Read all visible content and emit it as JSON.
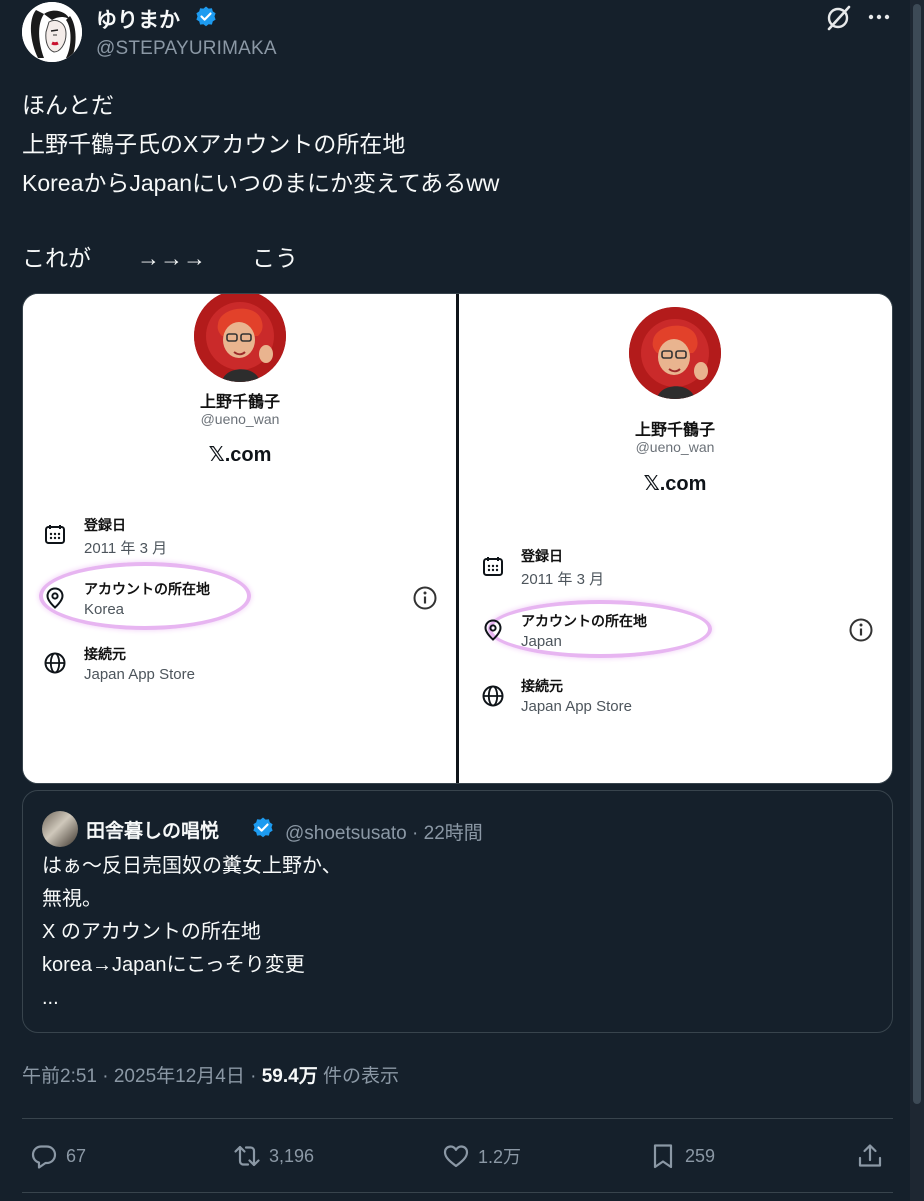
{
  "author": {
    "display_name": "ゆりまか",
    "handle": "@STEPAYURIMAKA",
    "verified": true
  },
  "icons": {
    "grok": "grok-slash-icon",
    "more": "more-icon",
    "reply": "reply-icon",
    "repost": "repost-icon",
    "like": "heart-icon",
    "bookmark": "bookmark-icon",
    "share": "share-icon"
  },
  "tweet_text": {
    "line1": "ほんとだ",
    "line2": "上野千鶴子氏のXアカウントの所在地",
    "line3": "KoreaからJapanにいつのまにか変えてあるww",
    "line4": "これが　　→→→　　こう"
  },
  "media": {
    "left": {
      "name": "上野千鶴子",
      "handle": "@ueno_wan",
      "site": "𝕏.com",
      "joined_label": "登録日",
      "joined_value": "2011 年 3 月",
      "location_label": "アカウントの所在地",
      "location_value": "Korea",
      "connected_label": "接続元",
      "connected_value": "Japan App Store"
    },
    "right": {
      "name": "上野千鶴子",
      "handle": "@ueno_wan",
      "site": "𝕏.com",
      "joined_label": "登録日",
      "joined_value": "2011 年 3 月",
      "location_label": "アカウントの所在地",
      "location_value": "Japan",
      "connected_label": "接続元",
      "connected_value": "Japan App Store"
    }
  },
  "quote": {
    "display_name": "田舎暮しの唱悦",
    "handle_time": "@shoetsusato · 22時間",
    "line1": "はぁ～反日売国奴の糞女上野か、",
    "line2": "無視。",
    "line3": "X のアカウントの所在地",
    "line4": "korea→Japanにこっそり変更",
    "line5": "..."
  },
  "meta": {
    "time_date": "午前2:51 · 2025年12月4日 · ",
    "views": "59.4万",
    "views_suffix": " 件の表示"
  },
  "actions": {
    "replies": "67",
    "reposts": "3,196",
    "likes": "1.2万",
    "bookmarks": "259"
  },
  "colors": {
    "background": "#15202b",
    "text": "#f7f9f9",
    "secondary": "#8b98a5",
    "verified": "#1d9bf0",
    "highlight": "#e7b5f1"
  }
}
